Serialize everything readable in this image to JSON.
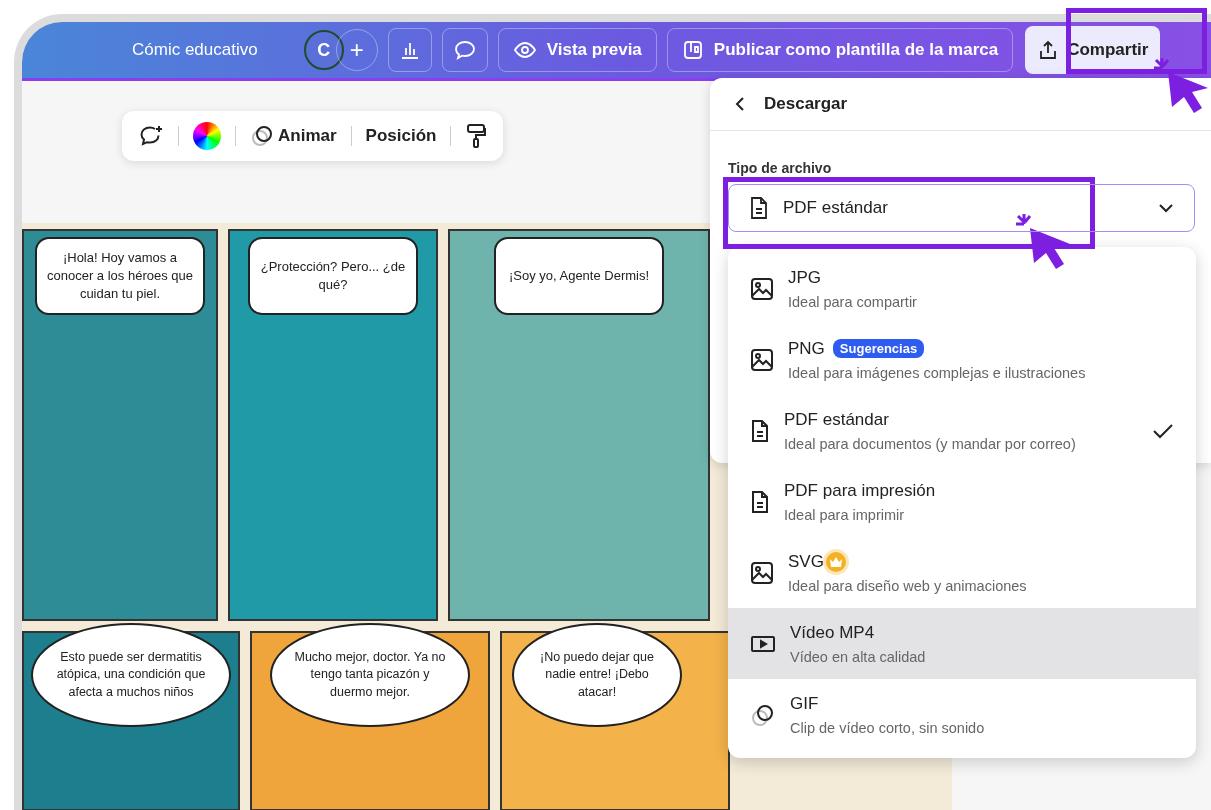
{
  "topbar": {
    "title": "Cómic educativo",
    "avatar": "C",
    "add": "+",
    "preview": "Vista previa",
    "publish": "Publicar como plantilla de la marca",
    "share": "Compartir"
  },
  "toolbar": {
    "animate": "Animar",
    "position": "Posición"
  },
  "comic": {
    "panels": [
      {
        "bubble": "¡Hola! Hoy vamos a conocer a los héroes que cuidan tu piel.",
        "color": "#2e8c96",
        "kind": "rect"
      },
      {
        "bubble": "¿Protección? Pero... ¿de qué?",
        "color": "#1f9aa6",
        "kind": "rect"
      },
      {
        "bubble": "¡Soy yo, Agente Dermis!",
        "color": "#6fb3ad",
        "kind": "rect"
      },
      {
        "bubble": "Esto puede ser dermatitis atópica, una condición que afecta a muchos niños",
        "color": "#1d7f8e",
        "kind": "oval"
      },
      {
        "bubble": "Mucho mejor, doctor. Ya no tengo tanta picazón y duermo mejor.",
        "color": "#f0a53c",
        "kind": "oval"
      },
      {
        "bubble": "¡No puedo dejar que nadie entre! ¡Debo atacar!",
        "color": "#f3b24a",
        "kind": "oval"
      }
    ]
  },
  "download": {
    "title": "Descargar",
    "file_type_label": "Tipo de archivo",
    "value": "PDF estándar",
    "options": [
      {
        "kind": "image",
        "label": "JPG",
        "description": "Ideal para compartir",
        "selected": false,
        "highlighted": false
      },
      {
        "kind": "image",
        "label": "PNG",
        "badge": "Sugerencias",
        "description": "Ideal para imágenes complejas e ilustraciones",
        "selected": false,
        "highlighted": false
      },
      {
        "kind": "document",
        "label": "PDF estándar",
        "description": "Ideal para documentos (y mandar por correo)",
        "selected": true,
        "highlighted": false
      },
      {
        "kind": "document",
        "label": "PDF para impresión",
        "description": "Ideal para imprimir",
        "selected": false,
        "highlighted": false
      },
      {
        "kind": "image",
        "label": "SVG",
        "premium": true,
        "description": "Ideal para diseño web y animaciones",
        "selected": false,
        "highlighted": false
      },
      {
        "kind": "video",
        "label": "Vídeo MP4",
        "description": "Vídeo en alta calidad",
        "selected": false,
        "highlighted": true
      },
      {
        "kind": "gif",
        "label": "GIF",
        "description": "Clip de vídeo corto, sin sonido",
        "selected": false,
        "highlighted": false
      }
    ]
  }
}
